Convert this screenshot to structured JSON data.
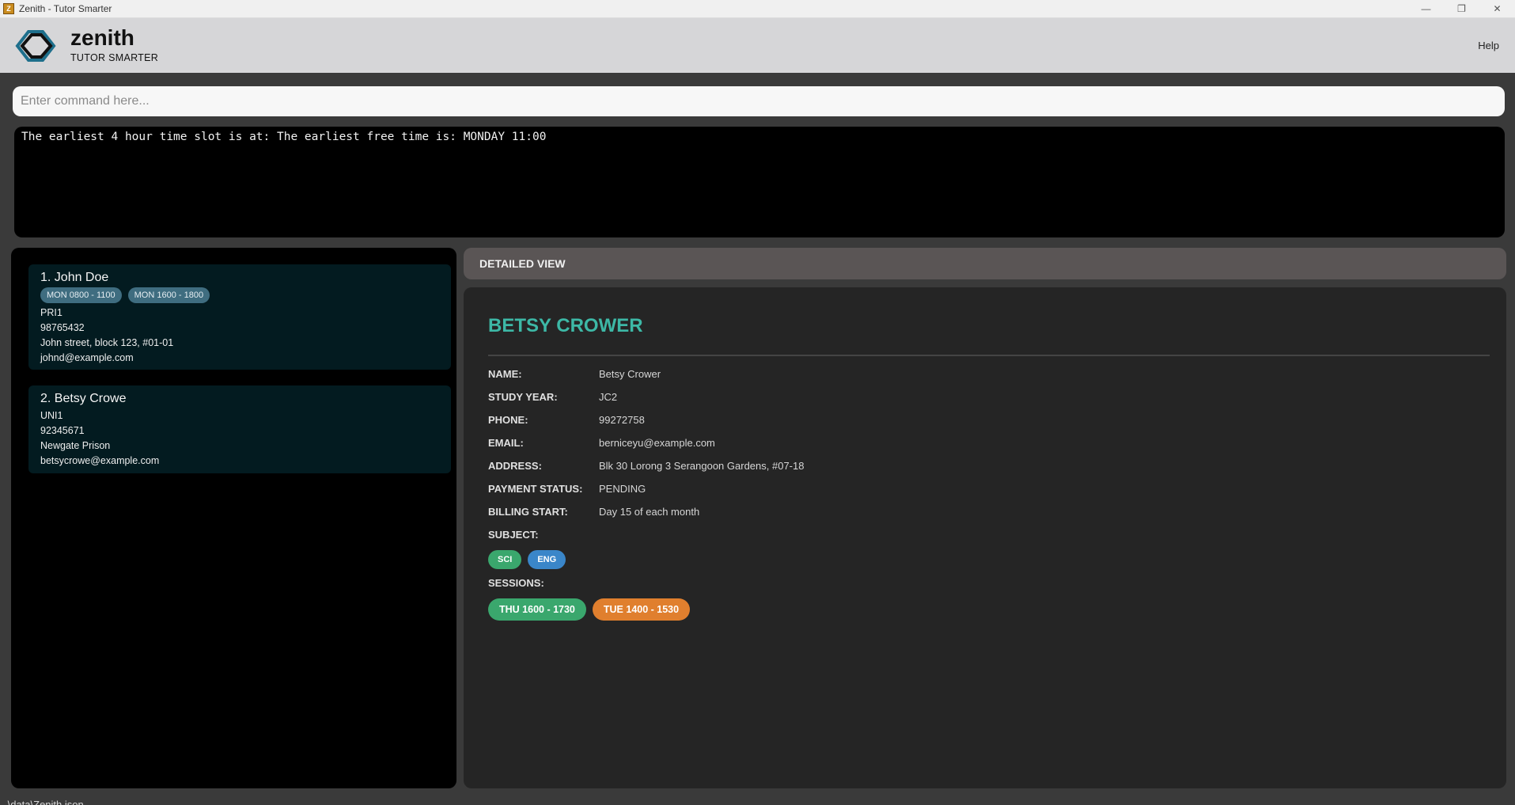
{
  "window": {
    "title": "Zenith - Tutor Smarter"
  },
  "header": {
    "brand_name": "zenith",
    "brand_tagline": "TUTOR SMARTER",
    "help_label": "Help"
  },
  "command": {
    "placeholder": "Enter command here..."
  },
  "result": {
    "text": "The earliest 4 hour time slot is at: The earliest free time is: MONDAY 11:00"
  },
  "student_list": [
    {
      "name": "1. John Doe",
      "sessions": [
        "MON 0800 - 1100",
        "MON 1600 - 1800"
      ],
      "level": "PRI1",
      "phone": "98765432",
      "address": "John street, block 123, #01-01",
      "email": "johnd@example.com"
    },
    {
      "name": "2. Betsy Crowe",
      "sessions": [],
      "level": "UNI1",
      "phone": "92345671",
      "address": "Newgate Prison",
      "email": "betsycrowe@example.com"
    }
  ],
  "detail": {
    "section_title": "DETAILED VIEW",
    "heading": "BETSY CROWER",
    "fields": [
      {
        "label": "NAME:",
        "value": "Betsy Crower"
      },
      {
        "label": "STUDY YEAR:",
        "value": "JC2"
      },
      {
        "label": "PHONE:",
        "value": "99272758"
      },
      {
        "label": "EMAIL:",
        "value": "berniceyu@example.com"
      },
      {
        "label": "ADDRESS:",
        "value": "Blk 30 Lorong 3 Serangoon Gardens, #07-18"
      },
      {
        "label": "PAYMENT STATUS:",
        "value": "PENDING"
      },
      {
        "label": "BILLING START:",
        "value": "Day 15 of each month"
      }
    ],
    "subject_label": "SUBJECT:",
    "subjects": [
      {
        "label": "SCI",
        "color": "#3aa76d"
      },
      {
        "label": "ENG",
        "color": "#3a86c9"
      }
    ],
    "sessions_label": "SESSIONS:",
    "sessions": [
      {
        "label": "THU 1600 - 1730",
        "color": "#3aa76d"
      },
      {
        "label": "TUE 1400 - 1530",
        "color": "#e07f2e"
      }
    ]
  },
  "status_bar": {
    "path": ".\\data\\Zenith.json"
  }
}
